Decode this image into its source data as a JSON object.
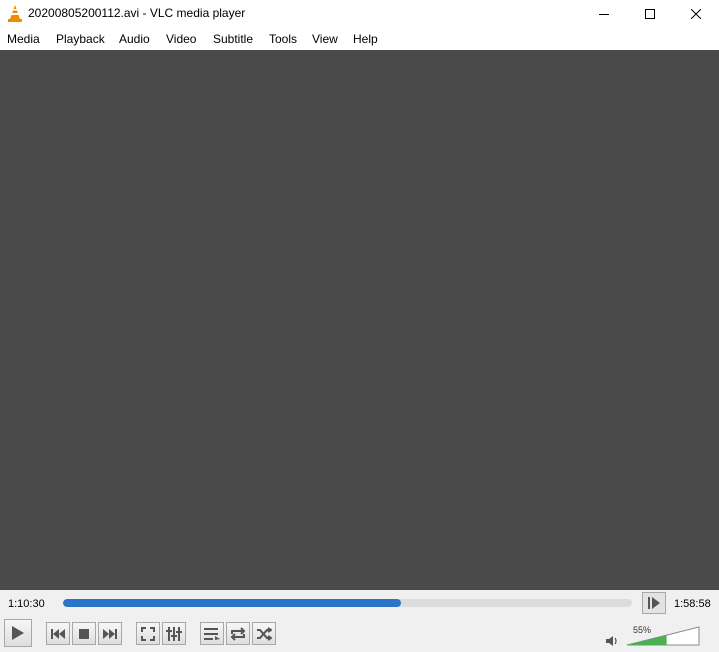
{
  "window": {
    "title": "20200805200112.avi - VLC media player",
    "minimize_icon": "minimize-icon",
    "maximize_icon": "maximize-icon",
    "close_icon": "close-icon"
  },
  "menu": {
    "items": [
      "Media",
      "Playback",
      "Audio",
      "Video",
      "Subtitle",
      "Tools",
      "View",
      "Help"
    ]
  },
  "player": {
    "elapsed": "1:10:30",
    "total": "1:58:58",
    "seek_progress": 0.5934,
    "volume_label": "55%",
    "volume_level": 0.55
  },
  "colors": {
    "video_background": "#4a4a4a",
    "seek_fill": "#2a75c8",
    "volume_fill": "#4caf50",
    "vlc_orange": "#f08c00"
  },
  "controls": {
    "icons": [
      "play-icon",
      "previous-icon",
      "stop-icon",
      "next-icon",
      "fullscreen-icon",
      "extended-settings-icon",
      "playlist-icon",
      "loop-icon",
      "shuffle-icon",
      "frame-by-frame-icon",
      "speaker-icon"
    ]
  }
}
